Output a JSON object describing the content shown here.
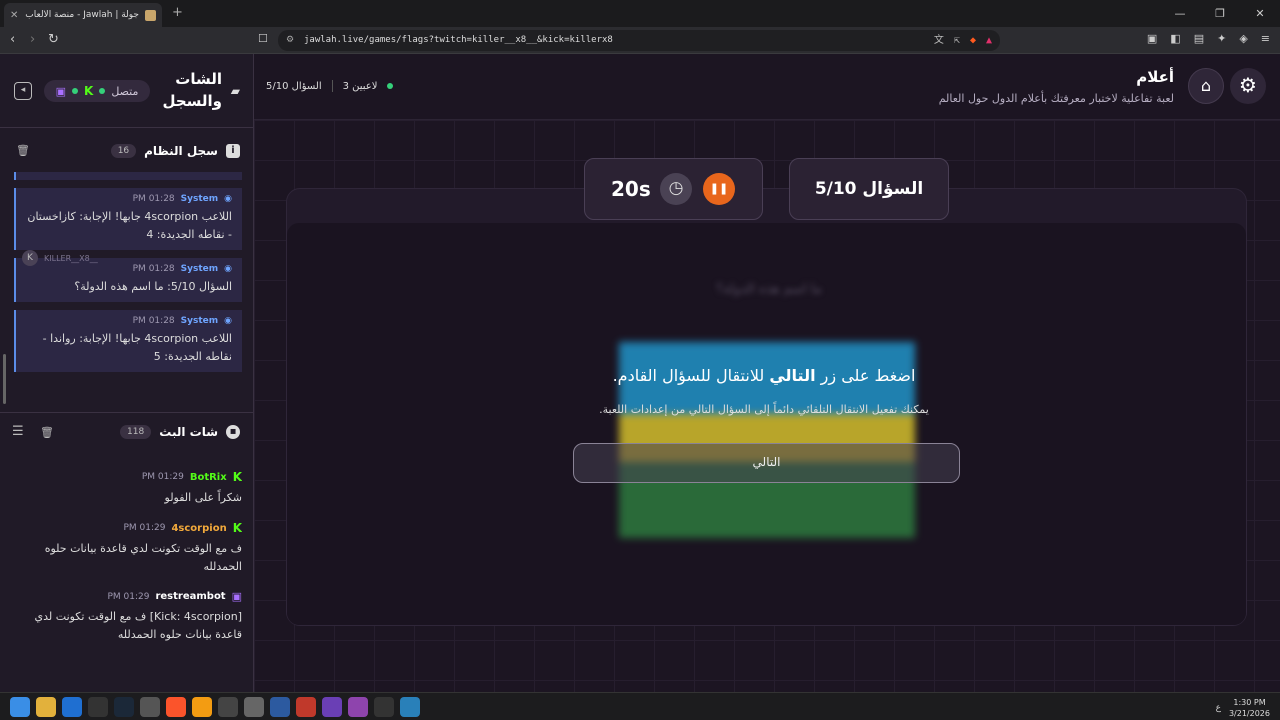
{
  "browser": {
    "tab_title": "جولة | Jawlah - منصة الألعاب التفا...",
    "url": "jawlah.live/games/flags?twitch=killer__x8__&kick=killerx8"
  },
  "sidebar": {
    "title_line1": "الشات",
    "title_line2": "والسجل",
    "status_label": "متصل",
    "system_log": {
      "label": "سجل النظام",
      "count": "16",
      "items": [
        {
          "name": "System",
          "time": "01:28 PM",
          "text": "اللاعب 4scorpion جابها! الإجابة: كازاخستان - نقاطه الجديدة: 4"
        },
        {
          "name": "System",
          "time": "01:28 PM",
          "text": "السؤال 5/10: ما اسم هذه الدولة؟"
        },
        {
          "name": "System",
          "time": "01:28 PM",
          "text": "اللاعب 4scorpion جابها! الإجابة: رواندا - نقاطه الجديدة: 5"
        }
      ],
      "user_tag": "KILLER__X8__"
    },
    "stream_chat": {
      "label": "شات البث",
      "count": "118",
      "items": [
        {
          "user": "BotRix",
          "time": "01:29 PM",
          "platform": "kick",
          "color": "#53fc18",
          "text": "شكراً على الفولو"
        },
        {
          "user": "4scorpion",
          "time": "01:29 PM",
          "platform": "kick",
          "color": "#f2a93b",
          "text": "ف مع الوقت تكونت لدي قاعدة بيانات حلوه الحمدلله"
        },
        {
          "user": "restreambot",
          "time": "01:29 PM",
          "platform": "twitch",
          "color": "#ffffff",
          "text": "[Kick: 4scorpion] ف مع الوقت تكونت لدي قاعدة بيانات حلوه الحمدلله"
        }
      ]
    }
  },
  "game": {
    "title": "أعلام",
    "subtitle": "لعبة تفاعلية لاختبار معرفتك بأعلام الدول حول العالم",
    "players": "3 لاعبين",
    "question_short": "السؤال 5/10",
    "question_box": "السؤال 5/10",
    "timer": "20s",
    "prompt_blurred": "ما اسم هذه الدولة؟",
    "overlay_pre": "اضغط على زر ",
    "overlay_bold": "التالي",
    "overlay_post": " للانتقال للسؤال القادم.",
    "overlay_sub": "يمكنك تفعيل الانتقال التلقائي دائماً إلى السؤال التالي من إعدادات اللعبة.",
    "next_button": "التالي"
  },
  "taskbar": {
    "time": "1:30 PM",
    "date": "3/21/2026",
    "lang": "ع"
  }
}
